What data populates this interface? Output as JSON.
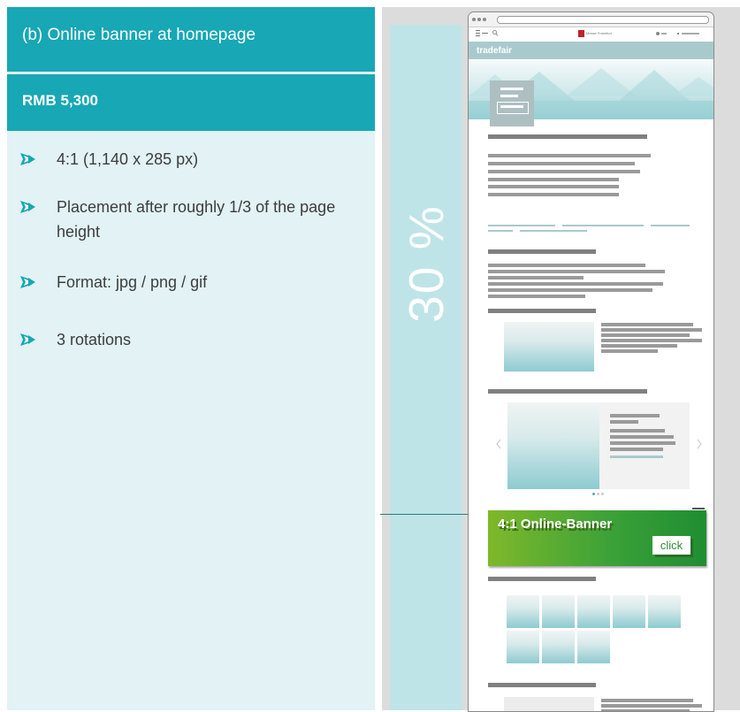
{
  "section": {
    "title": "(b) Online banner at homepage",
    "price": "RMB 5,300"
  },
  "bullets": [
    {
      "text": "4:1 (1,140 x 285 px)"
    },
    {
      "text": "Placement after roughly 1/3 of the page height"
    },
    {
      "text": "Format: jpg / png / gif"
    },
    {
      "text": "3 rotations"
    }
  ],
  "preview": {
    "percent_label": "30 %",
    "site_logo": "tradefair",
    "brand_label": "Messe Frankfurt",
    "banner_label": "4:1 Online-Banner",
    "banner_button": "click"
  },
  "colors": {
    "accent": "#17a7b5",
    "panel_bg": "#e2f2f5",
    "strip": "#bfe4e7",
    "banner_green": "#3ca238"
  },
  "icons": {
    "bullet": "arrow-bullet-icon",
    "menu": "hamburger-icon",
    "search": "search-icon",
    "carousel_prev": "chevron-left-icon",
    "carousel_next": "chevron-right-icon"
  }
}
